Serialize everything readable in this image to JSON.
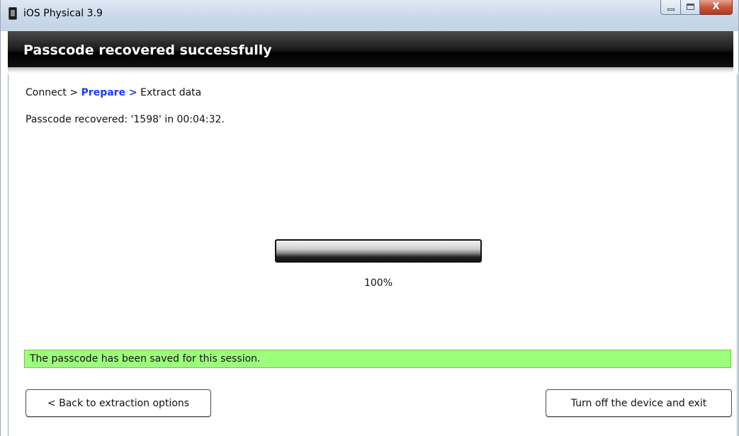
{
  "window": {
    "title": "iOS Physical 3.9",
    "close_glyph": "X"
  },
  "banner": {
    "title": "Passcode recovered successfully"
  },
  "breadcrumb": {
    "step1": "Connect >",
    "step2": "Prepare >",
    "step3": "Extract data"
  },
  "status": {
    "message": "Passcode recovered: '1598' in 00:04:32."
  },
  "progress": {
    "value_percent": 100,
    "label": "100%"
  },
  "notice": {
    "text": "The passcode has been saved for this session.",
    "color": "#9cff7c"
  },
  "buttons": {
    "back_label": "< Back to extraction options",
    "exit_label": "Turn off the device and exit"
  },
  "icons": {
    "app": "phone-icon",
    "minimize": "minimize-icon",
    "maximize": "maximize-icon",
    "close": "close-icon"
  },
  "colors": {
    "breadcrumb_active": "#1a3cf0",
    "banner_bg": "#000000"
  }
}
